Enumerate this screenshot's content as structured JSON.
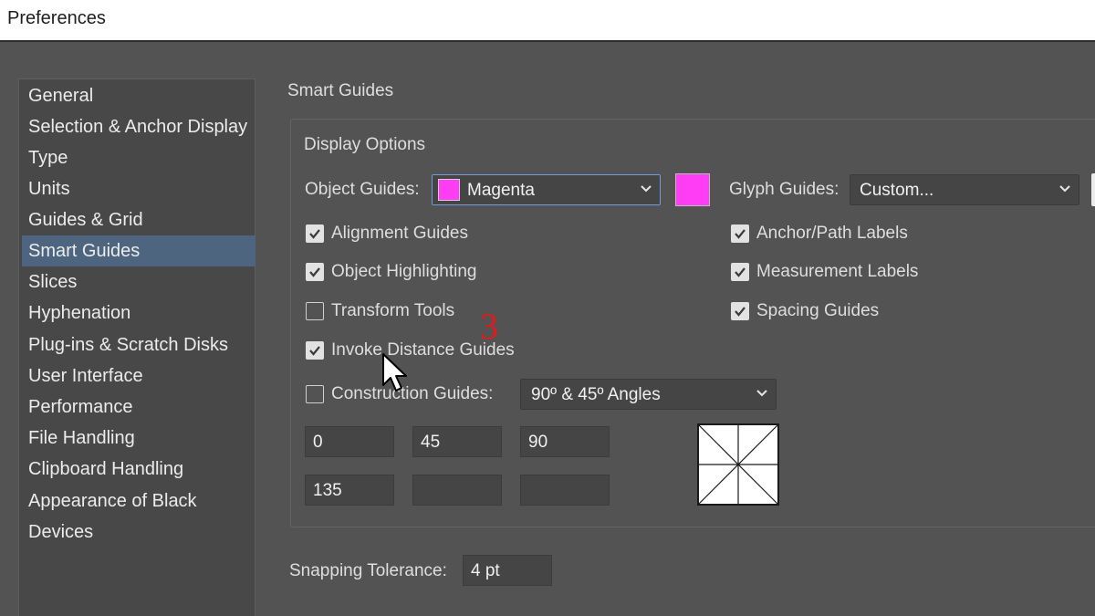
{
  "window": {
    "title": "Preferences"
  },
  "sidebar": {
    "items": [
      {
        "label": "General"
      },
      {
        "label": "Selection & Anchor Display"
      },
      {
        "label": "Type"
      },
      {
        "label": "Units"
      },
      {
        "label": "Guides & Grid"
      },
      {
        "label": "Smart Guides"
      },
      {
        "label": "Slices"
      },
      {
        "label": "Hyphenation"
      },
      {
        "label": "Plug-ins & Scratch Disks"
      },
      {
        "label": "User Interface"
      },
      {
        "label": "Performance"
      },
      {
        "label": "File Handling"
      },
      {
        "label": "Clipboard Handling"
      },
      {
        "label": "Appearance of Black"
      },
      {
        "label": "Devices"
      }
    ],
    "selected": "Smart Guides"
  },
  "main": {
    "section_title": "Smart Guides",
    "display_options": {
      "title": "Display Options",
      "object_guides": {
        "label": "Object Guides:",
        "value": "Magenta",
        "color": "#ff3df4"
      },
      "glyph_guides": {
        "label": "Glyph Guides:",
        "value": "Custom..."
      },
      "checkboxes_left": [
        {
          "label": "Alignment Guides",
          "checked": true
        },
        {
          "label": "Object Highlighting",
          "checked": true
        },
        {
          "label": "Transform Tools",
          "checked": false
        },
        {
          "label": "Invoke Distance Guides",
          "checked": true
        }
      ],
      "checkboxes_right": [
        {
          "label": "Anchor/Path Labels",
          "checked": true
        },
        {
          "label": "Measurement Labels",
          "checked": true
        },
        {
          "label": "Spacing Guides",
          "checked": true
        }
      ],
      "construction_guides": {
        "label": "Construction Guides:",
        "checked": false,
        "value": "90º & 45º Angles"
      },
      "angles": [
        "0",
        "45",
        "90",
        "135",
        "",
        ""
      ]
    },
    "snapping_tolerance": {
      "label": "Snapping Tolerance:",
      "value": "4 pt"
    }
  },
  "annotation": {
    "step_number": "3",
    "color": "#e01b1b"
  }
}
